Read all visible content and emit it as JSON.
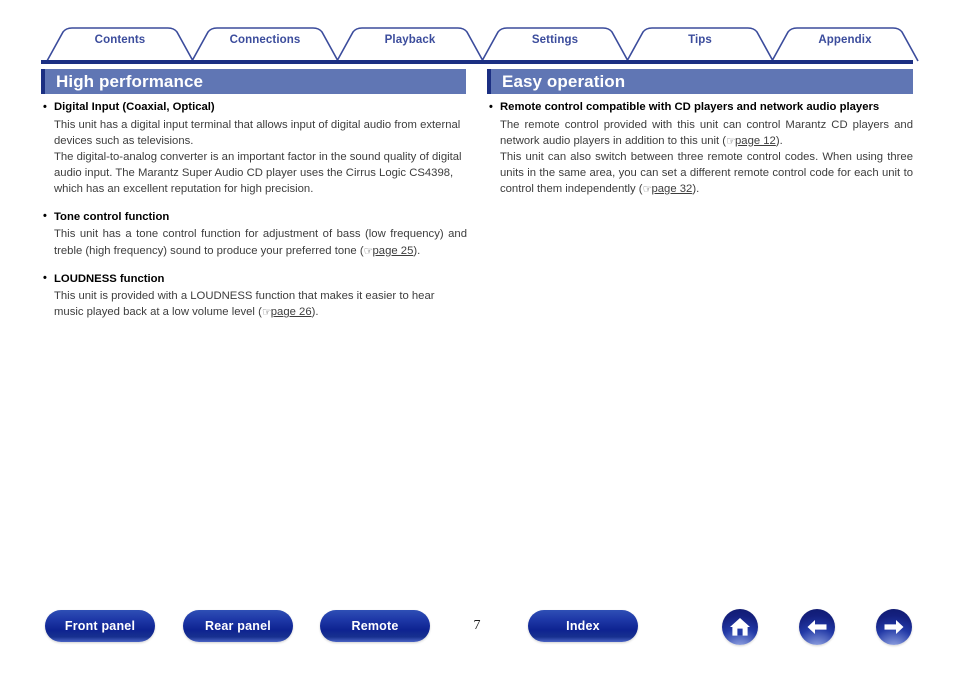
{
  "theme": {
    "tab_text": "#3b4c9c",
    "tab_border": "#3b4c9c",
    "rule_navy": "#1b2f82",
    "section_header_bg": "#6076b4",
    "section_header_edge": "#1b2f82",
    "button_blue": "#16309b",
    "body_text": "#3d3d3d"
  },
  "tabs": [
    {
      "label": "Contents",
      "name": "tab-contents"
    },
    {
      "label": "Connections",
      "name": "tab-connections"
    },
    {
      "label": "Playback",
      "name": "tab-playback"
    },
    {
      "label": "Settings",
      "name": "tab-settings"
    },
    {
      "label": "Tips",
      "name": "tab-tips"
    },
    {
      "label": "Appendix",
      "name": "tab-appendix"
    }
  ],
  "left_column": {
    "heading": "High performance",
    "blocks": [
      {
        "title": "Digital Input (Coaxial, Optical)",
        "paragraphs": [
          {
            "text": "This unit has a digital input terminal that allows input of digital audio from external devices such as televisions."
          },
          {
            "text": "The digital-to-analog converter is an important factor in the sound quality of digital audio input. The Marantz Super Audio CD player uses the Cirrus Logic CS4398, which has an excellent reputation for high precision."
          }
        ]
      },
      {
        "title": "Tone control function",
        "paragraphs": [
          {
            "text_before": "This unit has a tone control function for adjustment of bass (low frequency) and treble (high frequency) sound to produce your preferred tone (",
            "link": "page 25",
            "text_after": ")."
          }
        ]
      },
      {
        "title": "LOUDNESS function",
        "paragraphs": [
          {
            "text_before": "This unit is provided with a LOUDNESS function that makes it easier to hear music played back at a low volume level (",
            "link": "page 26",
            "text_after": ")."
          }
        ]
      }
    ]
  },
  "right_column": {
    "heading": "Easy operation",
    "blocks": [
      {
        "title": "Remote control compatible with CD players and network audio players",
        "paragraphs": [
          {
            "text_before": "The remote control provided with this unit can control Marantz CD players and network audio players in addition to this unit (",
            "link": "page 12",
            "text_after": ")."
          },
          {
            "text_before": "This unit can also switch between three remote control codes. When using three units in the same area, you can set a different remote control code for each unit to control them independently (",
            "link": "page 32",
            "text_after": ")."
          }
        ]
      }
    ]
  },
  "footer": {
    "buttons": [
      {
        "label": "Front panel",
        "name": "front-panel-button"
      },
      {
        "label": "Rear panel",
        "name": "rear-panel-button"
      },
      {
        "label": "Remote",
        "name": "remote-button"
      },
      {
        "label": "Index",
        "name": "index-button"
      }
    ],
    "page_number": "7",
    "icons": [
      {
        "name": "home-icon",
        "glyph": "home"
      },
      {
        "name": "arrow-left-icon",
        "glyph": "arrow-left"
      },
      {
        "name": "arrow-right-icon",
        "glyph": "arrow-right"
      }
    ]
  },
  "hand_icon": "☞"
}
